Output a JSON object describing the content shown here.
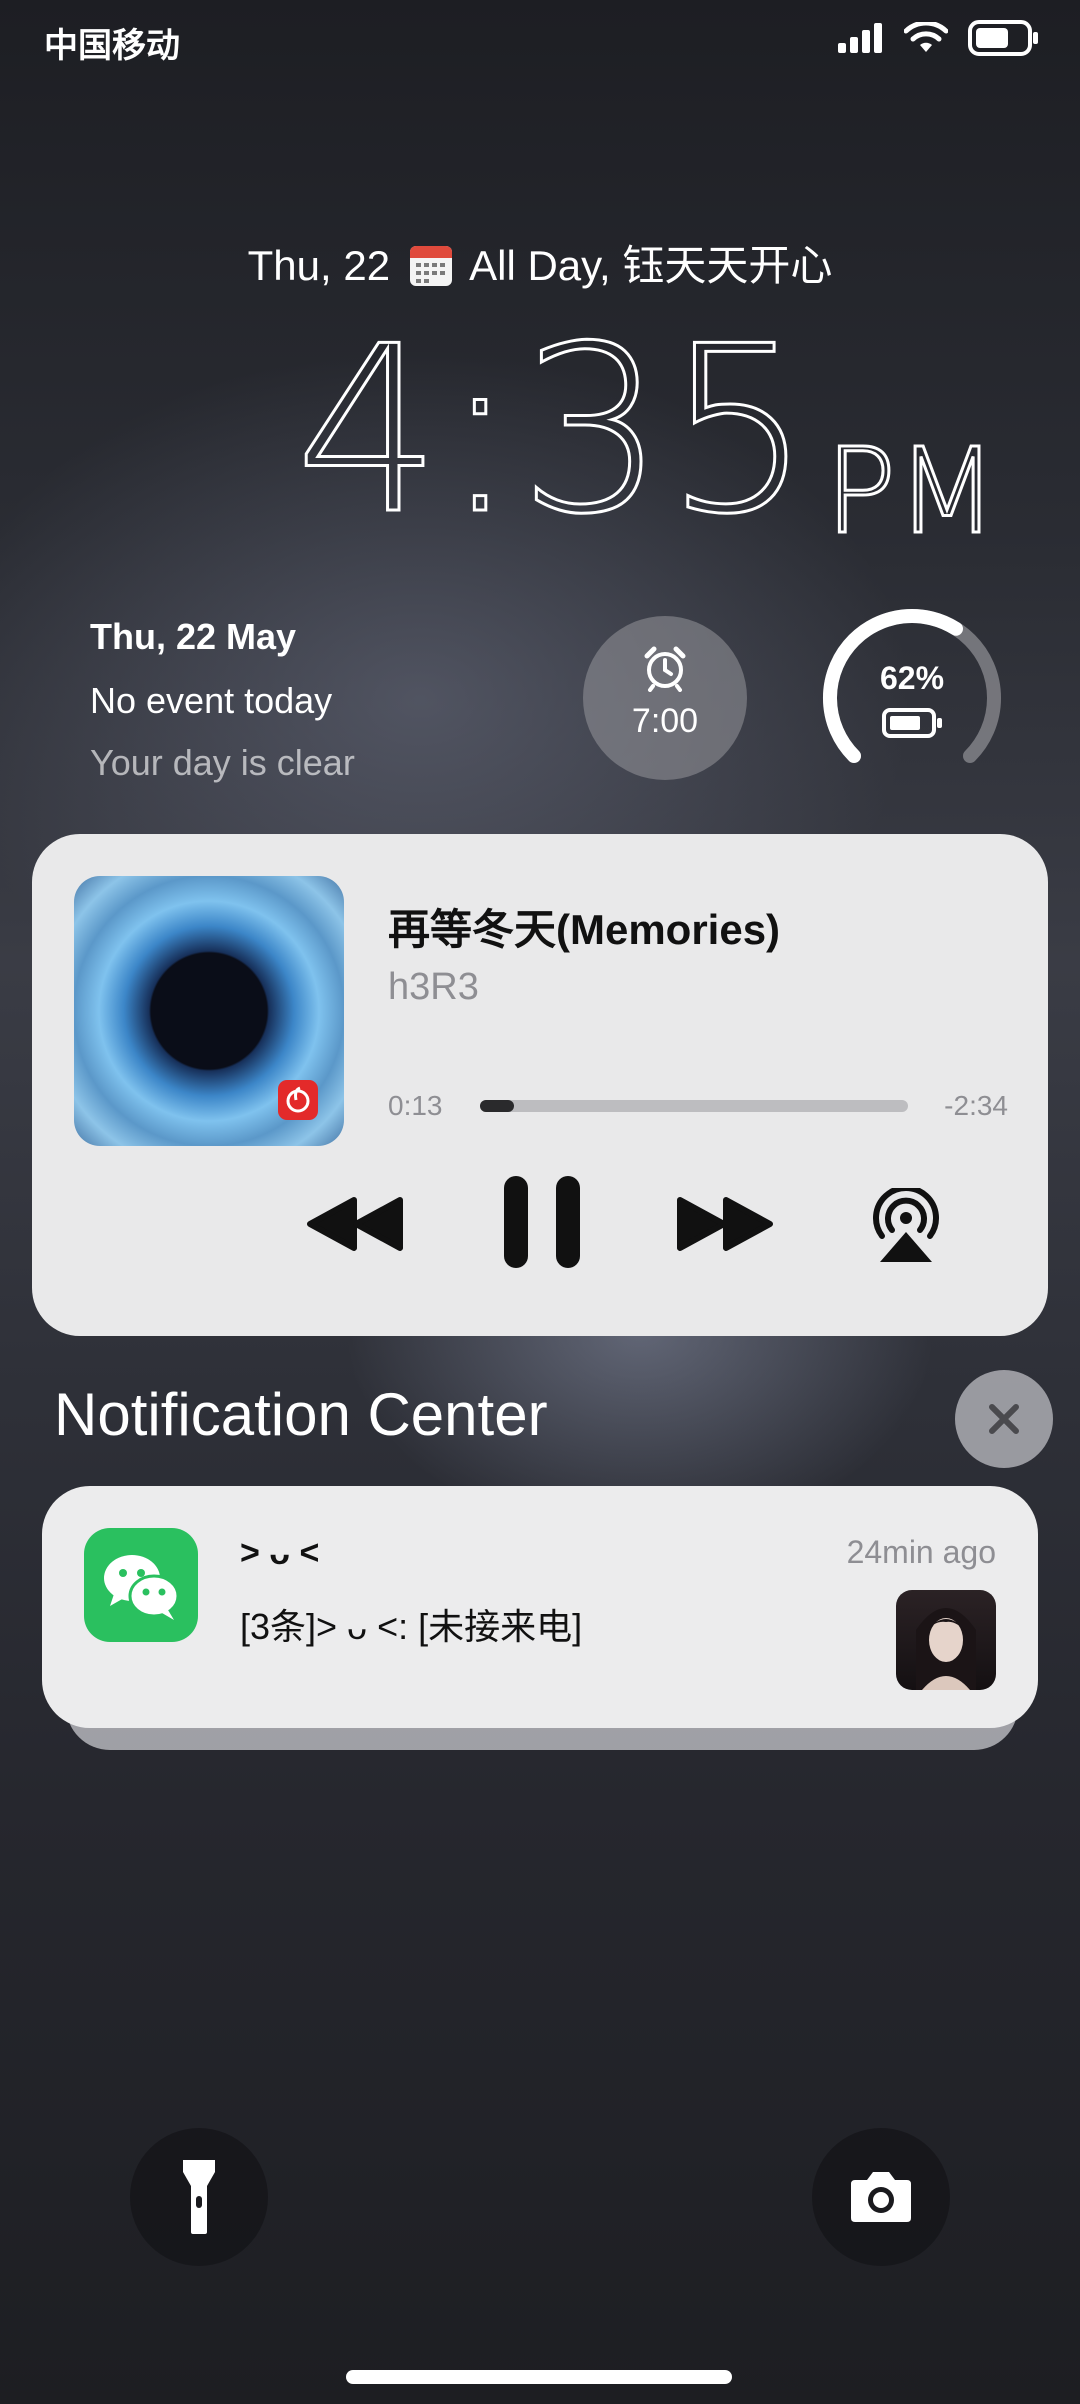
{
  "status_bar": {
    "carrier": "中国移动",
    "signal_icon": "signal-icon",
    "wifi_icon": "wifi-icon",
    "battery_icon": "battery-icon"
  },
  "header": {
    "date_line_start": "Thu, 22",
    "date_line_end": "All Day, 钰天天开心",
    "calendar_icon": "calendar-icon"
  },
  "clock": {
    "time": "4:35",
    "meridiem": "PM"
  },
  "widgets": {
    "date": "Thu, 22 May",
    "event": "No event today",
    "subtitle": "Your day is clear",
    "alarm_time": "7:00",
    "alarm_icon": "alarm-clock-icon",
    "battery_percent": "62%",
    "battery_level": 0.62
  },
  "music": {
    "title": "再等冬天(Memories)",
    "artist": "h3R3",
    "elapsed": "0:13",
    "remaining": "-2:34",
    "progress": 0.08,
    "controls": [
      "rewind-icon",
      "pause-icon",
      "fast-forward-icon",
      "airplay-icon"
    ]
  },
  "notification_center": {
    "title": "Notification Center",
    "clear_icon": "close-icon",
    "notification": {
      "app_icon": "wechat-icon",
      "sender": "> ᴗ <",
      "time": "24min ago",
      "message": "[3条]> ᴗ <: [未接来电]"
    }
  },
  "bottom": {
    "left_icon": "flashlight-icon",
    "right_icon": "camera-icon"
  },
  "colors": {
    "card_bg": "#e9e9ea",
    "wechat_green": "#2ac05f",
    "secondary_text": "#8e8e93"
  }
}
